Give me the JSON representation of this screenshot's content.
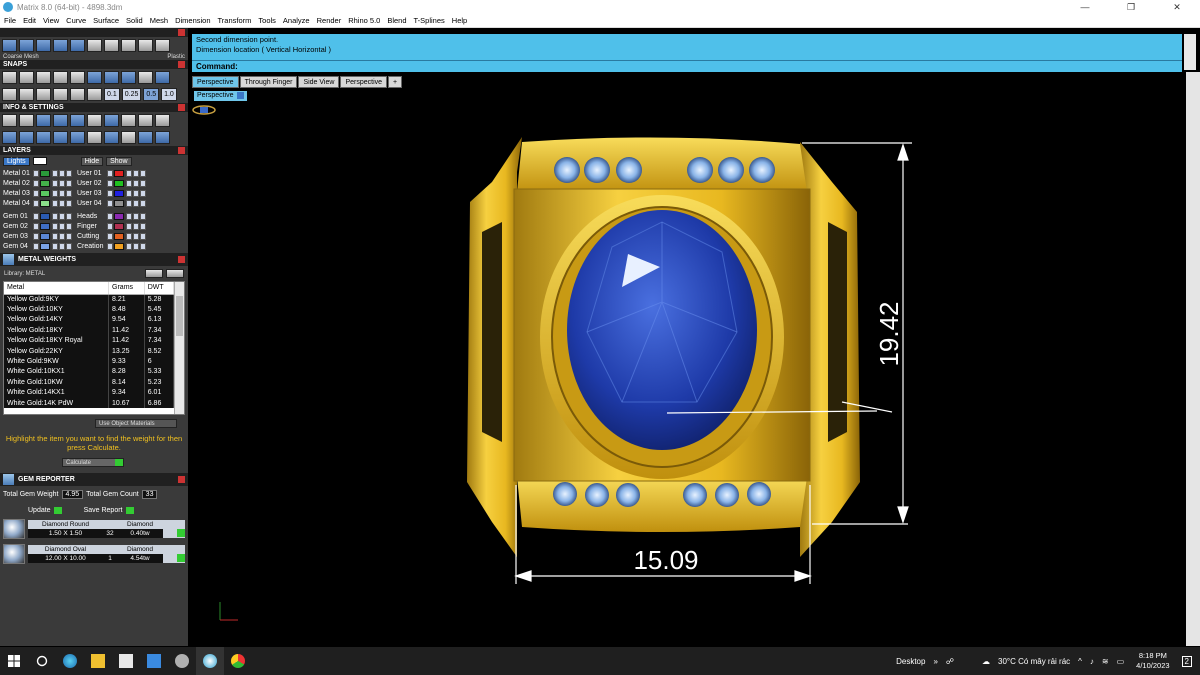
{
  "app": {
    "title": "Matrix 8.0 (64-bit) - 4898.3dm",
    "window_controls": [
      "—",
      "❐",
      "✕"
    ]
  },
  "menu": [
    "File",
    "Edit",
    "View",
    "Curve",
    "Surface",
    "Solid",
    "Mesh",
    "Dimension",
    "Transform",
    "Tools",
    "Analyze",
    "Render",
    "Rhino 5.0",
    "Blend",
    "T-Splines",
    "Help"
  ],
  "panel": {
    "mesh_labels": [
      "Coarse Mesh",
      "Plastic"
    ],
    "snaps_title": "SNAPS",
    "snap_values": [
      "0.1",
      "0.25",
      "0.5",
      "1.0"
    ],
    "info_title": "INFO & SETTINGS",
    "layers_title": "LAYERS",
    "lights_label": "Lights",
    "hide_label": "Hide",
    "show_label": "Show",
    "layers_left": [
      {
        "name": "Metal 01",
        "color": "#2a9a3a"
      },
      {
        "name": "Metal 02",
        "color": "#44b04a"
      },
      {
        "name": "Metal 03",
        "color": "#5ac860"
      },
      {
        "name": "Metal 04",
        "color": "#8ce08a"
      },
      {
        "name": "Gem 01",
        "color": "#2a5ab0"
      },
      {
        "name": "Gem 02",
        "color": "#3f6ec4"
      },
      {
        "name": "Gem 03",
        "color": "#5a86d4"
      },
      {
        "name": "Gem 04",
        "color": "#7aa2e4"
      }
    ],
    "layers_right": [
      {
        "name": "User 01",
        "color": "#e02020"
      },
      {
        "name": "User 02",
        "color": "#20c020"
      },
      {
        "name": "User 03",
        "color": "#2020e0"
      },
      {
        "name": "User 04",
        "color": "#909090"
      },
      {
        "name": "Heads",
        "color": "#8a2ab0"
      },
      {
        "name": "Finger",
        "color": "#b03050"
      },
      {
        "name": "Cutting",
        "color": "#e06020"
      },
      {
        "name": "Creation",
        "color": "#f0a020"
      }
    ]
  },
  "metal_weights": {
    "title": "METAL WEIGHTS",
    "library_label": "Library: METAL",
    "headers": [
      "Metal",
      "Grams",
      "DWT"
    ],
    "rows": [
      [
        "Yellow Gold:9KY",
        "8.21",
        "5.28"
      ],
      [
        "Yellow Gold:10KY",
        "8.48",
        "5.45"
      ],
      [
        "Yellow Gold:14KY",
        "9.54",
        "6.13"
      ],
      [
        "Yellow Gold:18KY",
        "11.42",
        "7.34"
      ],
      [
        "Yellow Gold:18KY Royal",
        "11.42",
        "7.34"
      ],
      [
        "Yellow Gold:22KY",
        "13.25",
        "8.52"
      ],
      [
        "White Gold:9KW",
        "9.33",
        "6"
      ],
      [
        "White Gold:10KX1",
        "8.28",
        "5.33"
      ],
      [
        "White Gold:10KW",
        "8.14",
        "5.23"
      ],
      [
        "White Gold:14KX1",
        "9.34",
        "6.01"
      ],
      [
        "White Gold:14K PdW",
        "10.67",
        "6.86"
      ]
    ],
    "use_object_label": "Use Object Materials",
    "hint": "Highlight the item you want to find the weight for then press Calculate.",
    "calculate_label": "Calculate"
  },
  "gem_reporter": {
    "title": "GEM REPORTER",
    "total_weight_label": "Total Gem Weight",
    "total_weight": "4.95",
    "total_count_label": "Total Gem Count",
    "total_count": "33",
    "update_label": "Update",
    "save_label": "Save Report",
    "gems": [
      {
        "shape": "Diamond Round",
        "material": "Diamond",
        "size": "1.50 X 1.50",
        "count": "32",
        "weight": "0.40tw"
      },
      {
        "shape": "Diamond Oval",
        "material": "Diamond",
        "size": "12.00 X 10.00",
        "count": "1",
        "weight": "4.54tw"
      }
    ]
  },
  "command": {
    "history": [
      "Second dimension point.",
      "Dimension location ( Vertical  Horizontal )"
    ],
    "prompt": "Command:"
  },
  "viewport": {
    "tabs": [
      "Perspective",
      "Through Finger",
      "Side View",
      "Perspective"
    ],
    "add_tab": "+",
    "active_label": "Perspective",
    "dim_vertical": "19.42",
    "dim_horizontal": "15.09"
  },
  "taskbar": {
    "desktop_label": "Desktop",
    "weather": "30°C  Có mây rải rác",
    "time": "8:18 PM",
    "date": "4/10/2023",
    "notif": "2"
  }
}
